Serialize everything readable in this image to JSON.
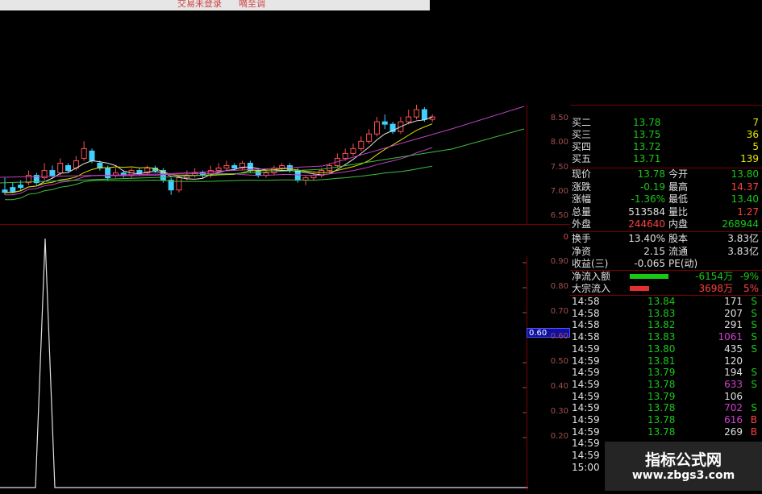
{
  "top_bar": {
    "left_text": "交易未登录",
    "right_text": "嘀至调"
  },
  "kline": {
    "price_ticks": [
      "8.50",
      "8.00",
      "7.50",
      "7.00",
      "6.50"
    ],
    "candles": [
      [
        7.05,
        7.0,
        7.3,
        6.95
      ],
      [
        7.1,
        7.0,
        7.2,
        6.98
      ],
      [
        7.15,
        7.1,
        7.25,
        7.05
      ],
      [
        7.2,
        7.35,
        7.45,
        7.15
      ],
      [
        7.35,
        7.2,
        7.4,
        7.15
      ],
      [
        7.3,
        7.45,
        7.6,
        7.25
      ],
      [
        7.45,
        7.35,
        7.55,
        7.3
      ],
      [
        7.4,
        7.6,
        7.7,
        7.35
      ],
      [
        7.55,
        7.45,
        7.6,
        7.4
      ],
      [
        7.5,
        7.65,
        7.75,
        7.45
      ],
      [
        7.7,
        7.9,
        8.05,
        7.65
      ],
      [
        7.85,
        7.65,
        7.9,
        7.6
      ],
      [
        7.6,
        7.5,
        7.65,
        7.45
      ],
      [
        7.5,
        7.3,
        7.55,
        7.25
      ],
      [
        7.35,
        7.4,
        7.5,
        7.3
      ],
      [
        7.4,
        7.35,
        7.45,
        7.3
      ],
      [
        7.35,
        7.45,
        7.5,
        7.3
      ],
      [
        7.45,
        7.4,
        7.5,
        7.35
      ],
      [
        7.4,
        7.5,
        7.55,
        7.35
      ],
      [
        7.5,
        7.45,
        7.55,
        7.4
      ],
      [
        7.45,
        7.25,
        7.5,
        7.2
      ],
      [
        7.25,
        7.05,
        7.3,
        6.95
      ],
      [
        7.05,
        7.3,
        7.35,
        7.0
      ],
      [
        7.3,
        7.35,
        7.45,
        7.25
      ],
      [
        7.35,
        7.4,
        7.5,
        7.3
      ],
      [
        7.4,
        7.35,
        7.45,
        7.3
      ],
      [
        7.35,
        7.45,
        7.55,
        7.3
      ],
      [
        7.45,
        7.5,
        7.6,
        7.4
      ],
      [
        7.5,
        7.55,
        7.65,
        7.45
      ],
      [
        7.55,
        7.5,
        7.6,
        7.45
      ],
      [
        7.5,
        7.6,
        7.65,
        7.45
      ],
      [
        7.6,
        7.45,
        7.65,
        7.4
      ],
      [
        7.45,
        7.35,
        7.5,
        7.3
      ],
      [
        7.35,
        7.4,
        7.45,
        7.3
      ],
      [
        7.4,
        7.5,
        7.55,
        7.35
      ],
      [
        7.5,
        7.55,
        7.6,
        7.45
      ],
      [
        7.55,
        7.45,
        7.6,
        7.4
      ],
      [
        7.45,
        7.25,
        7.5,
        7.2
      ],
      [
        7.25,
        7.3,
        7.35,
        7.15
      ],
      [
        7.3,
        7.35,
        7.4,
        7.25
      ],
      [
        7.35,
        7.45,
        7.5,
        7.3
      ],
      [
        7.45,
        7.55,
        7.6,
        7.4
      ],
      [
        7.55,
        7.7,
        7.8,
        7.5
      ],
      [
        7.7,
        7.8,
        7.9,
        7.65
      ],
      [
        7.8,
        7.9,
        8.0,
        7.75
      ],
      [
        7.9,
        8.05,
        8.15,
        7.85
      ],
      [
        8.05,
        8.2,
        8.3,
        8.0
      ],
      [
        8.2,
        8.45,
        8.55,
        8.15
      ],
      [
        8.45,
        8.4,
        8.6,
        8.3
      ],
      [
        8.4,
        8.25,
        8.45,
        8.2
      ],
      [
        8.25,
        8.45,
        8.55,
        8.2
      ],
      [
        8.45,
        8.55,
        8.7,
        8.4
      ],
      [
        8.55,
        8.7,
        8.85,
        8.5
      ],
      [
        8.7,
        8.5,
        8.75,
        8.45
      ],
      [
        8.5,
        8.55,
        8.6,
        8.45
      ]
    ]
  },
  "indicator": {
    "ticks": [
      "0.90",
      "0.80",
      "0.70",
      "0.60",
      "0.50",
      "0.40",
      "0.30",
      "0.20"
    ],
    "current_value": "0.60",
    "zero_label": "0"
  },
  "order_book": [
    {
      "label": "买二",
      "price": "13.78",
      "vol": "7"
    },
    {
      "label": "买三",
      "price": "13.75",
      "vol": "36"
    },
    {
      "label": "买四",
      "price": "13.72",
      "vol": "5"
    },
    {
      "label": "买五",
      "price": "13.71",
      "vol": "139"
    }
  ],
  "quote": [
    {
      "l1": "现价",
      "v1": "13.78",
      "c1": "green",
      "l2": "今开",
      "v2": "13.80",
      "c2": "green"
    },
    {
      "l1": "涨跌",
      "v1": "-0.19",
      "c1": "green",
      "l2": "最高",
      "v2": "14.37",
      "c2": "red"
    },
    {
      "l1": "涨幅",
      "v1": "-1.36%",
      "c1": "green",
      "l2": "最低",
      "v2": "13.40",
      "c2": "green"
    },
    {
      "l1": "总量",
      "v1": "513584",
      "c1": "white",
      "l2": "量比",
      "v2": "1.27",
      "c2": "red"
    },
    {
      "l1": "外盘",
      "v1": "244640",
      "c1": "red",
      "l2": "内盘",
      "v2": "268944",
      "c2": "green"
    }
  ],
  "fundamentals": [
    {
      "l1": "换手",
      "v1": "13.40%",
      "l2": "股本",
      "v2": "3.83亿"
    },
    {
      "l1": "净资",
      "v1": "2.15",
      "l2": "流通",
      "v2": "3.83亿"
    },
    {
      "l1": "收益(三)",
      "v1": "-0.065",
      "l2": "PE(动)",
      "v2": ""
    }
  ],
  "flows": [
    {
      "label": "净流入额",
      "value": "-6154万",
      "pct": "-9%",
      "color": "#19c819"
    },
    {
      "label": "大宗流入",
      "value": "3698万",
      "pct": "5%",
      "color": "#e03030"
    }
  ],
  "ticks_table": [
    {
      "time": "14:58",
      "price": "13.84",
      "vol": "171",
      "side": "S",
      "volColor": "white"
    },
    {
      "time": "14:58",
      "price": "13.83",
      "vol": "207",
      "side": "S",
      "volColor": "white"
    },
    {
      "time": "14:58",
      "price": "13.82",
      "vol": "291",
      "side": "S",
      "volColor": "white"
    },
    {
      "time": "14:58",
      "price": "13.83",
      "vol": "1061",
      "side": "S",
      "volColor": "purple"
    },
    {
      "time": "14:59",
      "price": "13.80",
      "vol": "435",
      "side": "S",
      "volColor": "white"
    },
    {
      "time": "14:59",
      "price": "13.81",
      "vol": "120",
      "side": "",
      "volColor": "white"
    },
    {
      "time": "14:59",
      "price": "13.79",
      "vol": "194",
      "side": "S",
      "volColor": "white"
    },
    {
      "time": "14:59",
      "price": "13.78",
      "vol": "633",
      "side": "S",
      "volColor": "purple"
    },
    {
      "time": "14:59",
      "price": "13.79",
      "vol": "106",
      "side": "",
      "volColor": "white"
    },
    {
      "time": "14:59",
      "price": "13.78",
      "vol": "702",
      "side": "S",
      "volColor": "purple"
    },
    {
      "time": "14:59",
      "price": "13.78",
      "vol": "616",
      "side": "B",
      "volColor": "purple"
    },
    {
      "time": "14:59",
      "price": "13.78",
      "vol": "269",
      "side": "B",
      "volColor": "white"
    },
    {
      "time": "14:59",
      "price": "",
      "vol": "",
      "side": "",
      "volColor": "white"
    },
    {
      "time": "14:59",
      "price": "",
      "vol": "",
      "side": "",
      "volColor": "white"
    },
    {
      "time": "15:00",
      "price": "",
      "vol": "",
      "side": "",
      "volColor": "white"
    }
  ],
  "watermark": {
    "title": "指标公式网",
    "url": "www.zbgs3.com"
  }
}
